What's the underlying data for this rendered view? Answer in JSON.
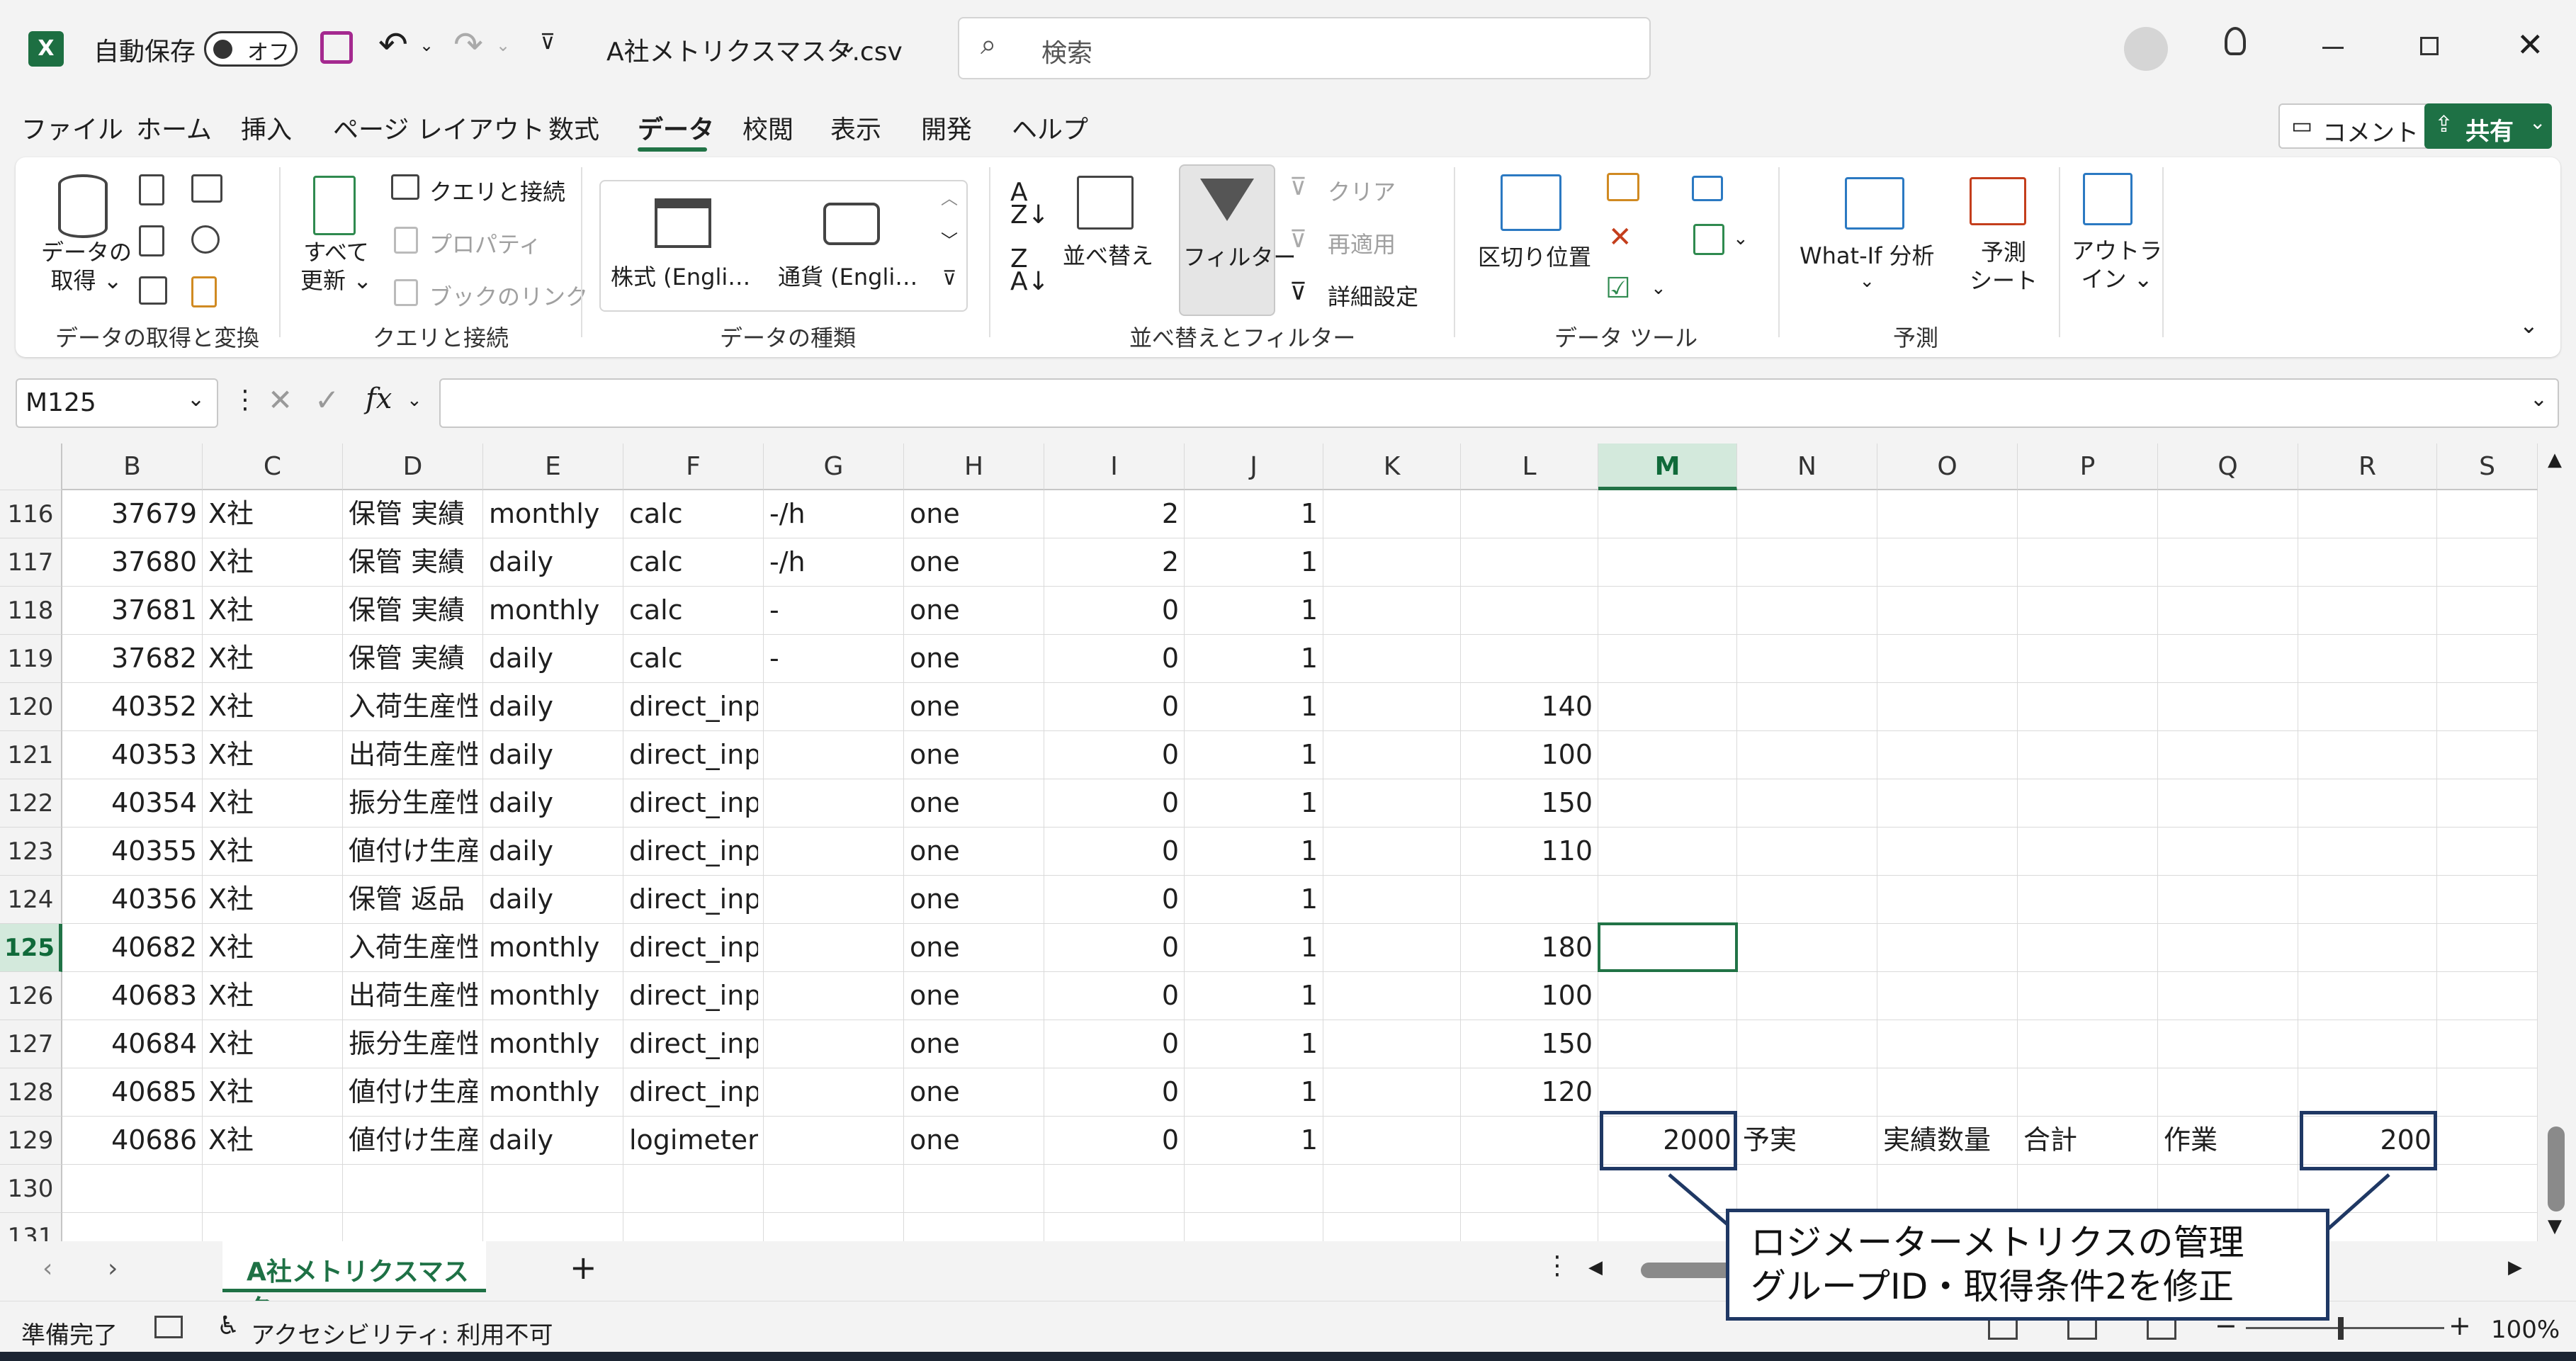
{
  "titlebar": {
    "autosave_label": "自動保存",
    "autosave_state": "オフ",
    "filename": "A社メトリクスマスタ.csv",
    "search_placeholder": "検索"
  },
  "menu": [
    "ファイル",
    "ホーム",
    "挿入",
    "ページ レイアウト",
    "数式",
    "データ",
    "校閲",
    "表示",
    "開発",
    "ヘルプ"
  ],
  "menu_active": "データ",
  "buttons": {
    "comment": "コメント",
    "share": "共有"
  },
  "ribbon": {
    "get_data": [
      "データの",
      "取得"
    ],
    "refresh_all": [
      "すべて",
      "更新"
    ],
    "queries_connections": "クエリと接続",
    "properties": "プロパティ",
    "edit_links": "ブックのリンク",
    "stocks": "株式 (Engli…",
    "currencies": "通貨 (Engli…",
    "sort": "並べ替え",
    "filter": "フィルター",
    "clear": "クリア",
    "reapply": "再適用",
    "advanced": "詳細設定",
    "text_to_columns": "区切り位置",
    "what_if": "What-If 分析",
    "forecast": [
      "予測",
      "シート"
    ],
    "outline": [
      "アウトラ",
      "イン"
    ],
    "groups": {
      "get_transform": "データの取得と変換",
      "queries": "クエリと接続",
      "data_types": "データの種類",
      "sort_filter": "並べ替えとフィルター",
      "data_tools": "データ ツール",
      "forecast": "予測"
    }
  },
  "formula_bar": {
    "name_box": "M125",
    "formula": ""
  },
  "columns": [
    "B",
    "C",
    "D",
    "E",
    "F",
    "G",
    "H",
    "I",
    "J",
    "K",
    "L",
    "M",
    "N",
    "O",
    "P",
    "Q",
    "R",
    "S"
  ],
  "selected_column": "M",
  "selected_row": "125",
  "rows": [
    {
      "n": "116",
      "B": "37679",
      "C": "X社",
      "D": "保管 実績",
      "E": "monthly",
      "F": "calc",
      "G": "-/h",
      "H": "one",
      "I": "2",
      "J": "1",
      "L": ""
    },
    {
      "n": "117",
      "B": "37680",
      "C": "X社",
      "D": "保管 実績",
      "E": "daily",
      "F": "calc",
      "G": "-/h",
      "H": "one",
      "I": "2",
      "J": "1",
      "L": ""
    },
    {
      "n": "118",
      "B": "37681",
      "C": "X社",
      "D": "保管 実績",
      "E": "monthly",
      "F": "calc",
      "G": "-",
      "H": "one",
      "I": "0",
      "J": "1",
      "L": ""
    },
    {
      "n": "119",
      "B": "37682",
      "C": "X社",
      "D": "保管 実績",
      "E": "daily",
      "F": "calc",
      "G": "-",
      "H": "one",
      "I": "0",
      "J": "1",
      "L": ""
    },
    {
      "n": "120",
      "B": "40352",
      "C": "X社",
      "D": "入荷生産性",
      "E": "daily",
      "F": "direct_input",
      "G": "",
      "H": "one",
      "I": "0",
      "J": "1",
      "L": "140"
    },
    {
      "n": "121",
      "B": "40353",
      "C": "X社",
      "D": "出荷生産性",
      "E": "daily",
      "F": "direct_input",
      "G": "",
      "H": "one",
      "I": "0",
      "J": "1",
      "L": "100"
    },
    {
      "n": "122",
      "B": "40354",
      "C": "X社",
      "D": "振分生産性",
      "E": "daily",
      "F": "direct_input",
      "G": "",
      "H": "one",
      "I": "0",
      "J": "1",
      "L": "150"
    },
    {
      "n": "123",
      "B": "40355",
      "C": "X社",
      "D": "値付け生産",
      "E": "daily",
      "F": "direct_input",
      "G": "",
      "H": "one",
      "I": "0",
      "J": "1",
      "L": "110"
    },
    {
      "n": "124",
      "B": "40356",
      "C": "X社",
      "D": "保管 返品",
      "E": "daily",
      "F": "direct_input",
      "G": "",
      "H": "one",
      "I": "0",
      "J": "1",
      "L": ""
    },
    {
      "n": "125",
      "B": "40682",
      "C": "X社",
      "D": "入荷生産性",
      "E": "monthly",
      "F": "direct_input",
      "G": "",
      "H": "one",
      "I": "0",
      "J": "1",
      "L": "180"
    },
    {
      "n": "126",
      "B": "40683",
      "C": "X社",
      "D": "出荷生産性",
      "E": "monthly",
      "F": "direct_input",
      "G": "",
      "H": "one",
      "I": "0",
      "J": "1",
      "L": "100"
    },
    {
      "n": "127",
      "B": "40684",
      "C": "X社",
      "D": "振分生産性",
      "E": "monthly",
      "F": "direct_input",
      "G": "",
      "H": "one",
      "I": "0",
      "J": "1",
      "L": "150"
    },
    {
      "n": "128",
      "B": "40685",
      "C": "X社",
      "D": "値付け生産",
      "E": "monthly",
      "F": "direct_input",
      "G": "",
      "H": "one",
      "I": "0",
      "J": "1",
      "L": "120"
    },
    {
      "n": "129",
      "B": "40686",
      "C": "X社",
      "D": "値付け生産",
      "E": "daily",
      "F": "logimeter",
      "G": "",
      "H": "one",
      "I": "0",
      "J": "1",
      "L": "",
      "M": "2000",
      "N": "予実",
      "O": "実績数量",
      "P": "合計",
      "Q": "作業",
      "R": "200"
    },
    {
      "n": "130"
    },
    {
      "n": "131"
    }
  ],
  "sheet_tab": "A社メトリクスマスタ",
  "status": {
    "ready": "準備完了",
    "accessibility": "アクセシビリティ: 利用不可",
    "zoom": "100%"
  },
  "callout_text": [
    "ロジメーターメトリクスの管理",
    "グループID・取得条件2を修正"
  ]
}
